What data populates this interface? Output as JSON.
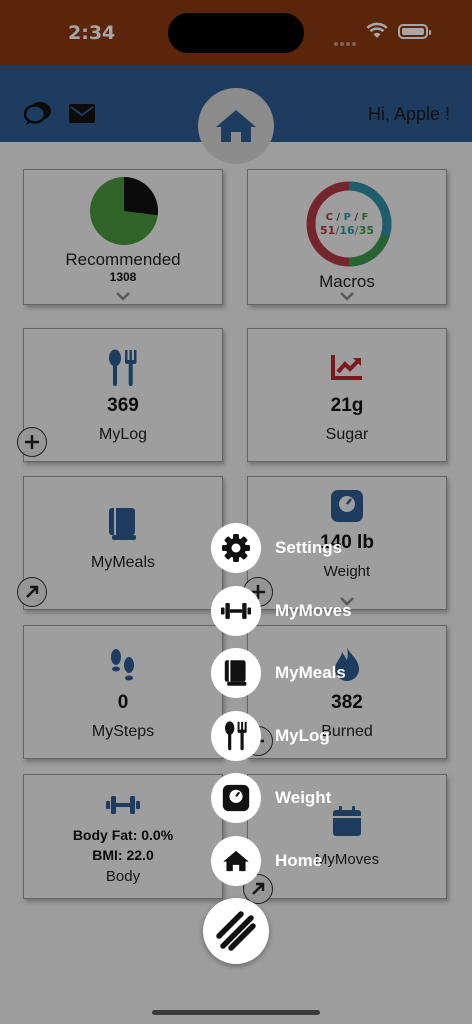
{
  "status": {
    "time": "2:34"
  },
  "header": {
    "greeting": "Hi, Apple !",
    "chat_icon": "chat-bubble-icon",
    "mail_icon": "envelope-icon",
    "home_icon": "home-icon"
  },
  "cards": {
    "recommended": {
      "label": "Recommended",
      "value": "1308",
      "pie_fraction_black": 0.27
    },
    "macros": {
      "label": "Macros",
      "header": "C / P / F",
      "c": "51",
      "p": "16",
      "f": "35",
      "sep": "/"
    },
    "mylog": {
      "value": "369",
      "label": "MyLog"
    },
    "sugar": {
      "value": "21g",
      "label": "Sugar"
    },
    "mymeals": {
      "label": "MyMeals"
    },
    "weight": {
      "value": "140 lb",
      "label": "Weight"
    },
    "mysteps": {
      "value": "0",
      "label": "MySteps"
    },
    "burned": {
      "value": "382",
      "label": "Burned"
    },
    "body": {
      "body_fat": "Body Fat: 0.0%",
      "bmi": "BMI: 22.0",
      "label": "Body"
    },
    "mymoves": {
      "label": "MyMoves"
    }
  },
  "fab_menu": [
    {
      "label": "Settings",
      "icon": "gear-icon"
    },
    {
      "label": "MyMoves",
      "icon": "dumbbell-icon"
    },
    {
      "label": "MyMeals",
      "icon": "book-icon"
    },
    {
      "label": "MyLog",
      "icon": "utensils-icon"
    },
    {
      "label": "Weight",
      "icon": "scale-icon"
    },
    {
      "label": "Home",
      "icon": "home-icon"
    }
  ],
  "colors": {
    "brand_blue": "#2f5c93",
    "status_bar": "#8a3a10",
    "pie_green": "#4a9a3e",
    "sugar_red": "#c0262b",
    "macro_c": "#b33a48",
    "macro_p": "#2f9a9a",
    "macro_f": "#3c9a50"
  }
}
